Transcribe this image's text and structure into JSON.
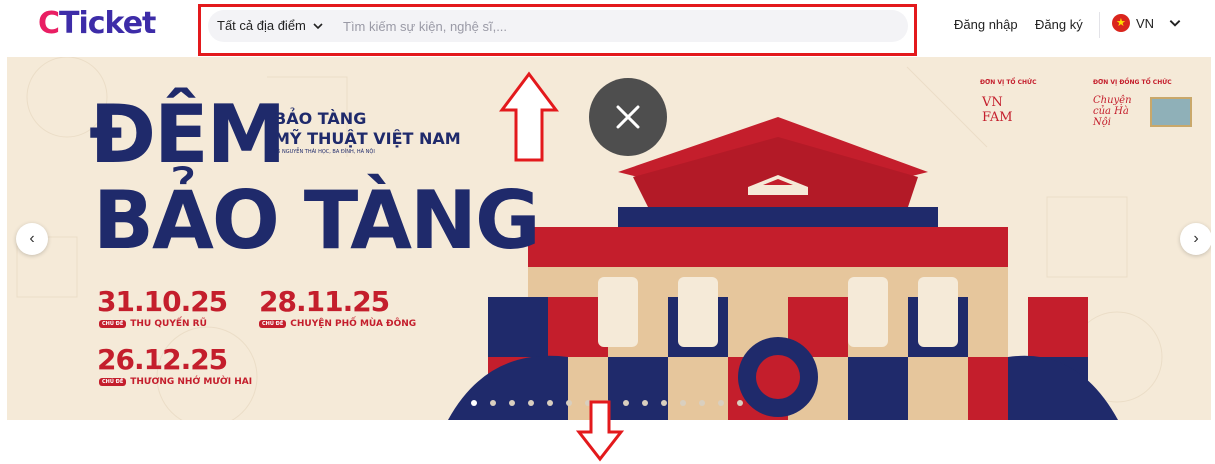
{
  "header": {
    "logo": {
      "c": "C",
      "rest": "Ticket"
    },
    "search": {
      "location_label": "Tất cả địa điểm",
      "placeholder": "Tìm kiếm sự kiện, nghệ sĩ,..."
    },
    "login_label": "Đăng nhập",
    "register_label": "Đăng ký",
    "language": {
      "code": "VN",
      "flag": "vietnam-flag-icon"
    }
  },
  "banner": {
    "title_line1": "ĐÊM",
    "title_line2": "BẢO TÀNG",
    "museum_line1": "BẢO TÀNG",
    "museum_line2": "MỸ THUẬT VIỆT NAM",
    "museum_address": "66 NGUYỄN THÁI HỌC, BA ĐÌNH, HÀ NỘI",
    "organizer_label": "ĐƠN VỊ TỔ CHỨC",
    "co_organizer_label": "ĐƠN VỊ ĐỒNG TỔ CHỨC",
    "organizer_logo": "VN FAM",
    "co_organizer_logo": "Chuyện của Hà Nội",
    "events": [
      {
        "date": "31.10.25",
        "tag": "CHỦ ĐỀ",
        "theme": "THU QUYẾN RŨ"
      },
      {
        "date": "28.11.25",
        "tag": "CHỦ ĐỀ",
        "theme": "CHUYỆN PHỐ MÙA ĐÔNG"
      },
      {
        "date": "26.12.25",
        "tag": "CHỦ ĐỀ",
        "theme": "THƯƠNG NHỚ MƯỜI HAI"
      }
    ],
    "slide_count": 15,
    "active_slide": 1,
    "prev_icon": "‹",
    "next_icon": "›"
  },
  "colors": {
    "brand_pink": "#e91e63",
    "brand_purple": "#3d2ca8",
    "navy": "#1f2a6b",
    "red": "#c41e2c",
    "cream": "#f5ead8",
    "annotation_red": "#e3191c"
  }
}
